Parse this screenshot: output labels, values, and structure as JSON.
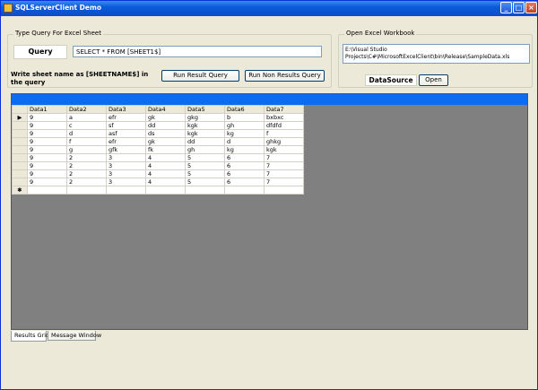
{
  "window": {
    "title": "SQLServerClient Demo",
    "controls": [
      "_",
      "□",
      "×"
    ]
  },
  "query_group": {
    "label": "Type Query For Excel Sheet",
    "query_label": "Query",
    "query_value": "SELECT * FROM [SHEET1$]",
    "hint": "Write sheet name as [SHEETNAME$] in the query",
    "run_result_button": "Run Result Query",
    "run_non_result_button": "Run Non Results Query"
  },
  "workbook_group": {
    "label": "Open Excel Workbook",
    "path": [
      "E:\\Visual Studio",
      "Projects\\C#\\MicrosoftExcelClient\\bin\\Release\\SampleData.xls"
    ],
    "datasource_label": "DataSource",
    "open_button": "Open"
  },
  "grid": {
    "columns": [
      "Data1",
      "Data2",
      "Data3",
      "Data4",
      "Data5",
      "Data6",
      "Data7"
    ],
    "rows": [
      [
        "9",
        "a",
        "efr",
        "gk",
        "gkg",
        "b",
        "bxbxc"
      ],
      [
        "9",
        "c",
        "sf",
        "dd",
        "kgk",
        "gh",
        "dfdfd"
      ],
      [
        "9",
        "d",
        "asf",
        "ds",
        "kgk",
        "kg",
        "f"
      ],
      [
        "9",
        "f",
        "efr",
        "gk",
        "dd",
        "d",
        "ghkg"
      ],
      [
        "9",
        "g",
        "gfk",
        "fk",
        "gh",
        "kg",
        "kgk"
      ],
      [
        "9",
        "2",
        "3",
        "4",
        "5",
        "6",
        "7"
      ],
      [
        "9",
        "2",
        "3",
        "4",
        "5",
        "6",
        "7"
      ],
      [
        "9",
        "2",
        "3",
        "4",
        "5",
        "6",
        "7"
      ],
      [
        "9",
        "2",
        "3",
        "4",
        "5",
        "6",
        "7"
      ]
    ],
    "current_row_marker": "▶",
    "new_row_marker": "✱"
  },
  "tabs": [
    "Results Grid",
    "Message Window"
  ],
  "colors": {
    "title_bar": "#0b5bd9",
    "grid_header": "#0a6cf0",
    "grid_background": "#808080"
  }
}
